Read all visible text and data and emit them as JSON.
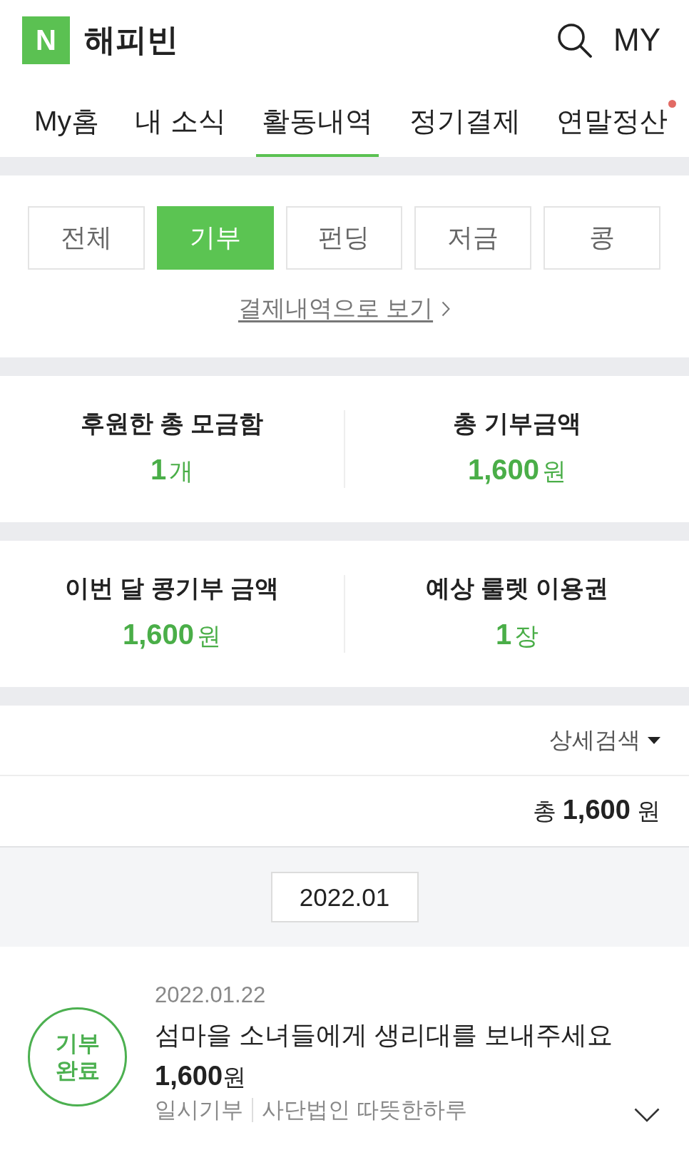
{
  "header": {
    "logo_letter": "N",
    "title": "해피빈",
    "my_label": "MY"
  },
  "tabs": [
    {
      "label": "My홈",
      "selected": false,
      "notification": false
    },
    {
      "label": "내 소식",
      "selected": false,
      "notification": false
    },
    {
      "label": "활동내역",
      "selected": true,
      "notification": false
    },
    {
      "label": "정기결제",
      "selected": false,
      "notification": false
    },
    {
      "label": "연말정산",
      "selected": false,
      "notification": true
    }
  ],
  "filters": [
    {
      "label": "전체",
      "selected": false
    },
    {
      "label": "기부",
      "selected": true
    },
    {
      "label": "펀딩",
      "selected": false
    },
    {
      "label": "저금",
      "selected": false
    },
    {
      "label": "콩",
      "selected": false
    }
  ],
  "history_link": {
    "label": "결제내역으로 보기"
  },
  "stat_groups": [
    {
      "items": [
        {
          "label": "후원한 총 모금함",
          "value": "**1**개"
        },
        {
          "label": "총 기부금액",
          "value": "**1,600**원"
        }
      ]
    },
    {
      "items": [
        {
          "label": "이번 달 콩기부 금액",
          "value": "**1,600**원"
        },
        {
          "label": "예상 룰렛 이용권",
          "value": "**1**장"
        }
      ]
    }
  ],
  "detail_search": {
    "label": "상세검색",
    "expanded": false
  },
  "total": {
    "text": "총 **1,600** 원"
  },
  "month": {
    "label": "2022.01"
  },
  "donations": [
    {
      "date": "2022.01.22",
      "status": "기부 완료",
      "title": "섬마을 소녀들에게 생리대를 보내주세요",
      "amount": "**1,600**원",
      "type": "일시기부",
      "organization": "사단법인 따뜻한하루",
      "expanded": false
    }
  ]
}
